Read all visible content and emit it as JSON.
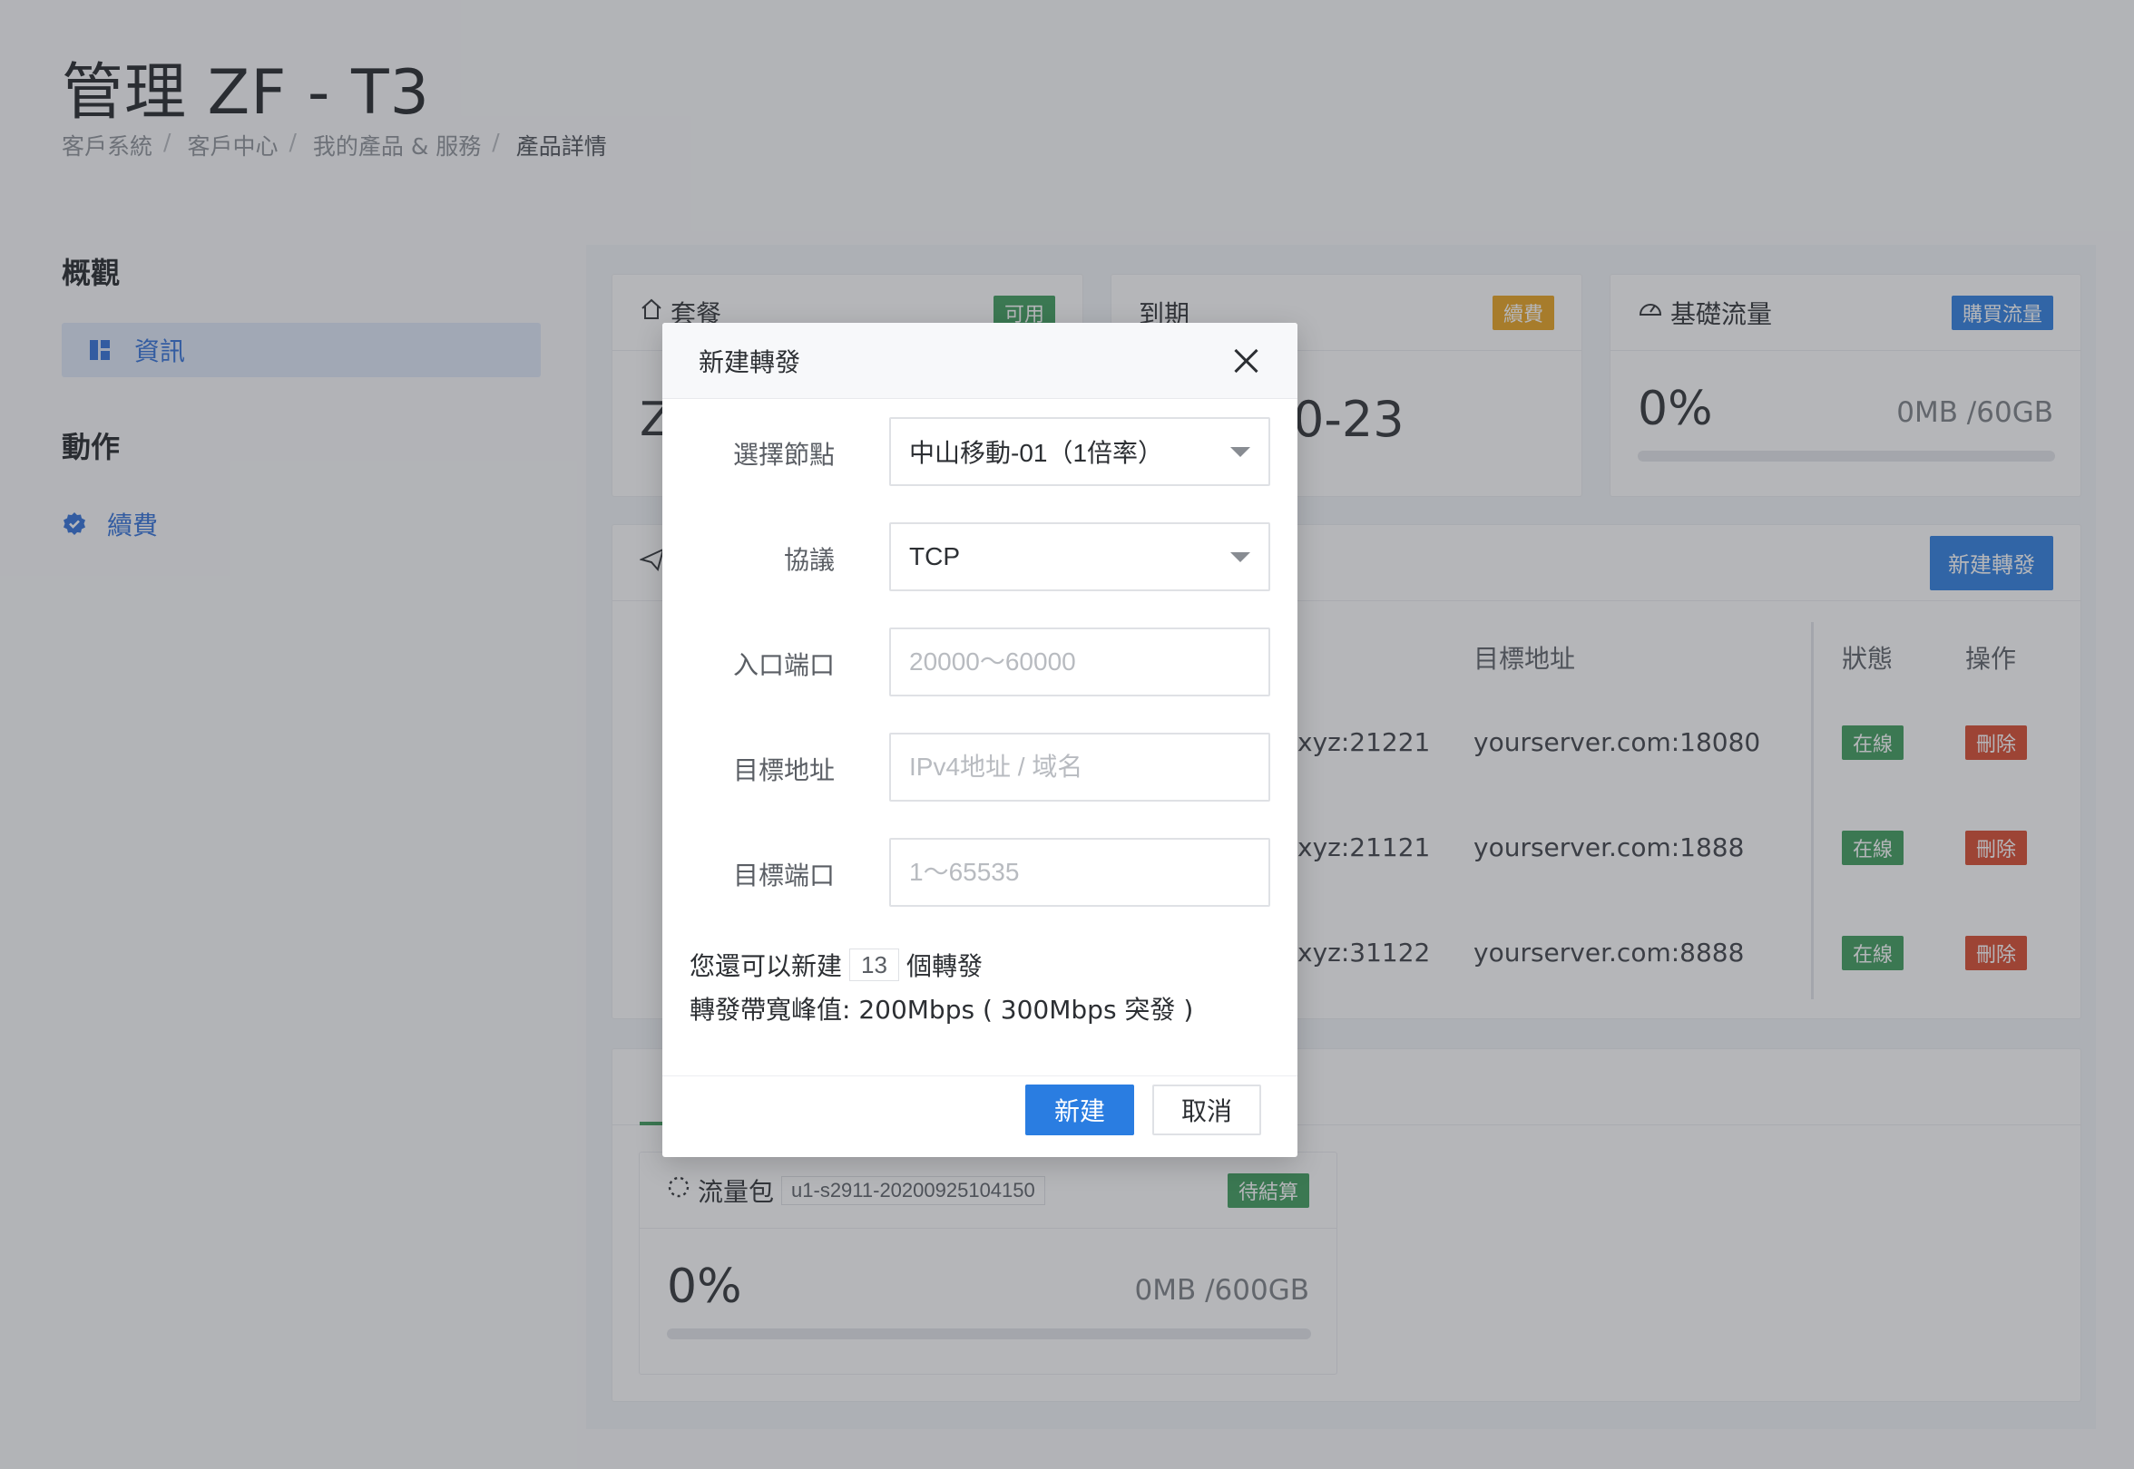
{
  "page": {
    "title": "管理 ZF - T3",
    "breadcrumb": [
      "客戶系統",
      "客戶中心",
      "我的產品 & 服務",
      "產品詳情"
    ]
  },
  "sidebar": {
    "overview_heading": "概觀",
    "info_item": "資訊",
    "actions_heading": "動作",
    "renew_item": "續費"
  },
  "cards": {
    "plan": {
      "title": "套餐",
      "badge": "可用",
      "value_partial": "Z"
    },
    "expiry": {
      "title": "到期",
      "badge": "續費",
      "value_partial": "0-23"
    },
    "traffic": {
      "title": "基礎流量",
      "badge": "購買流量",
      "percent": "0%",
      "usage": "0MB /60GB",
      "progress": 0
    }
  },
  "forwards": {
    "new_button": "新建轉發",
    "columns": {
      "target": "目標地址",
      "status": "狀態",
      "action": "操作"
    },
    "rows": [
      {
        "entry": "xyz:21221",
        "target": "yourserver.com:18080",
        "status": "在線",
        "action": "刪除"
      },
      {
        "entry": "xyz:21121",
        "target": "yourserver.com:1888",
        "status": "在線",
        "action": "刪除"
      },
      {
        "entry": "xyz:31122",
        "target": "yourserver.com:8888",
        "status": "在線",
        "action": "刪除"
      }
    ]
  },
  "package": {
    "title": "流量包",
    "id": "u1-s2911-20200925104150",
    "badge": "待結算",
    "percent": "0%",
    "usage": "0MB /600GB",
    "progress": 0
  },
  "modal": {
    "title": "新建轉發",
    "node_label": "選擇節點",
    "node_value": "中山移動-01（1倍率）",
    "protocol_label": "協議",
    "protocol_value": "TCP",
    "entry_port_label": "入口端口",
    "entry_port_placeholder": "20000～60000",
    "target_addr_label": "目標地址",
    "target_addr_placeholder": "IPv4地址 / 域名",
    "target_port_label": "目標端口",
    "target_port_placeholder": "1～65535",
    "remaining_prefix": "您還可以新建",
    "remaining_count": "13",
    "remaining_suffix": "個轉發",
    "bandwidth_text": "轉發帶寬峰值: 200Mbps ( 300Mbps 突發 )",
    "create_button": "新建",
    "cancel_button": "取消"
  },
  "colors": {
    "primary": "#2a7de1",
    "success": "#3a9c5a",
    "warning": "#e9a21a",
    "danger": "#d9472b"
  }
}
